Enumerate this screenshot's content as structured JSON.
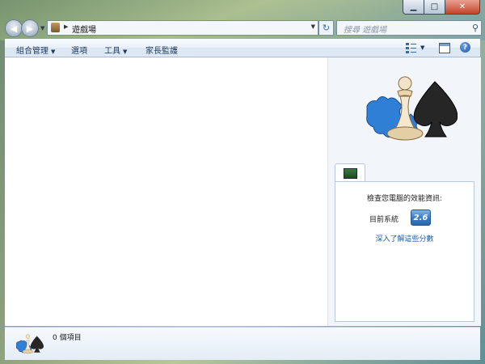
{
  "window": {
    "minimize_label": "▁",
    "maximize_label": "□",
    "close_label": "✕"
  },
  "address": {
    "location": "遊戲場",
    "search_placeholder": "搜尋 遊戲場"
  },
  "toolbar": {
    "organize_label": "組合管理",
    "options_label": "選項",
    "tools_label": "工具",
    "parental_controls_label": "家長監護"
  },
  "details": {
    "perf_title": "檢查您電腦的效能資訊:",
    "current_system_label": "目前系統",
    "score": "2.6",
    "learn_more_link": "深入了解這些分數"
  },
  "status": {
    "item_count": "0 個項目"
  },
  "colors": {
    "accent": "#1a5ca8",
    "score_badge": "#3a7fc6"
  },
  "icons": {
    "back": "arrow-left",
    "forward": "arrow-right",
    "refresh": "refresh",
    "search": "magnifier",
    "help": "question-mark"
  }
}
